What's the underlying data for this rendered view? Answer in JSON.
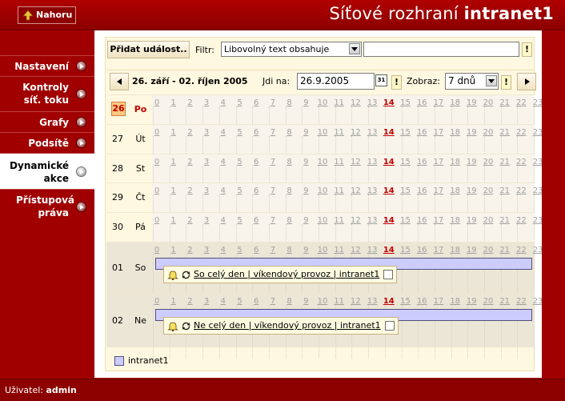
{
  "header": {
    "up_button": "Nahoru",
    "title_prefix": "Síťové rozhraní",
    "title_name": "intranet1"
  },
  "sidebar": {
    "items": [
      {
        "label": "Nastavení",
        "active": false
      },
      {
        "label": "Kontroly síť. toku",
        "active": false
      },
      {
        "label": "Grafy",
        "active": false
      },
      {
        "label": "Podsítě",
        "active": false
      },
      {
        "label": "Dynamické akce",
        "active": true
      },
      {
        "label": "Přístupová práva",
        "active": false
      }
    ]
  },
  "toolbar": {
    "add_event": "Přidat událost..",
    "filter_label": "Filtr:",
    "filter_select": "Libovolný text obsahuje",
    "filter_value": "",
    "filter_go": "!"
  },
  "navbar": {
    "date_range": "26. září - 02. říjen 2005",
    "goto_label": "Jdi na:",
    "goto_value": "26.9.2005",
    "calendar_icon_text": "31",
    "goto_go": "!",
    "view_label": "Zobraz:",
    "view_value": "7 dnů",
    "view_go": "!"
  },
  "calendar": {
    "hours": [
      "0",
      "1",
      "2",
      "3",
      "4",
      "5",
      "6",
      "7",
      "8",
      "9",
      "10",
      "11",
      "12",
      "13",
      "14",
      "15",
      "16",
      "17",
      "18",
      "19",
      "20",
      "21",
      "22",
      "23"
    ],
    "current_hour": "14",
    "days": [
      {
        "num": "26",
        "name": "Po",
        "today": true,
        "weekend": false
      },
      {
        "num": "27",
        "name": "Út",
        "today": false,
        "weekend": false
      },
      {
        "num": "28",
        "name": "St",
        "today": false,
        "weekend": false
      },
      {
        "num": "29",
        "name": "Čt",
        "today": false,
        "weekend": false
      },
      {
        "num": "30",
        "name": "Pá",
        "today": false,
        "weekend": false
      },
      {
        "num": "01",
        "name": "So",
        "today": false,
        "weekend": true,
        "event": "So celý den | víkendový provoz | intranet1"
      },
      {
        "num": "02",
        "name": "Ne",
        "today": false,
        "weekend": true,
        "event": "Ne celý den | víkendový provoz | intranet1"
      }
    ]
  },
  "legend": {
    "items": [
      {
        "label": "intranet1",
        "color": "#ccccff"
      }
    ]
  },
  "footer": {
    "user_label": "Uživatel:",
    "user_name": "admin"
  },
  "colors": {
    "brand": "#a00000",
    "panel": "#fef8e0",
    "event": "#ccccff",
    "today": "#f8c880",
    "current_hour": "#c00000"
  }
}
